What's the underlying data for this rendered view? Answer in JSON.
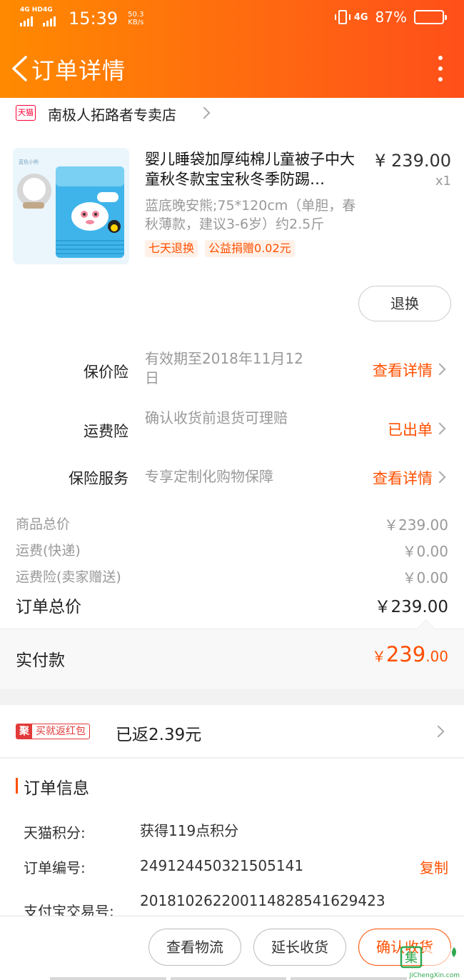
{
  "status_bar": {
    "net1": "4G HD",
    "net2": "4G",
    "time": "15:39",
    "speed_value": "50.3",
    "speed_unit": "KB/s",
    "net3": "4G",
    "battery_pct": "87%",
    "battery_level": 0.87
  },
  "nav": {
    "title": "订单详情"
  },
  "shop": {
    "badge": "天猫",
    "name": "南极人拓路者专卖店"
  },
  "product": {
    "title": "婴儿睡袋加厚纯棉儿童被子中大童秋冬款宝宝秋冬季防踢…",
    "price": "¥ 239.00",
    "qty": "x1",
    "sku": "蓝底晚安熊;75*120cm（单胆，春秋薄款，建议3-6岁）约2.5斤",
    "tags": [
      "七天退换",
      "公益捐赠0.02元"
    ],
    "return_button": "退换"
  },
  "services": [
    {
      "label": "保价险",
      "desc": "有效期至2018年11月12日",
      "link": "查看详情"
    },
    {
      "label": "运费险",
      "desc": "确认收货前退货可理赔",
      "link": "已出单"
    },
    {
      "label": "保险服务",
      "desc": "专享定制化购物保障",
      "link": "查看详情"
    }
  ],
  "costs": [
    {
      "label": "商品总价",
      "value": "￥239.00"
    },
    {
      "label": "运费(快递)",
      "value": "￥0.00"
    },
    {
      "label": "运费险(卖家赠送)",
      "value": "￥0.00"
    }
  ],
  "total": {
    "label": "订单总价",
    "value": "￥239.00"
  },
  "paid": {
    "label": "实付款",
    "currency": "￥",
    "integer": "239",
    "decimal": ".00"
  },
  "packet": {
    "badge_icon": "聚",
    "badge_text": "买就返红包",
    "text": "已返2.39元"
  },
  "order_info": {
    "title": "订单信息",
    "rows": [
      {
        "key": "天猫积分:",
        "value": "获得119点积分"
      },
      {
        "key": "订单编号:",
        "value": "249124450321505141",
        "action": "复制"
      },
      {
        "key": "支付宝交易号:",
        "value": "201810262200114828541629423"
      }
    ]
  },
  "actions": {
    "logistics": "查看物流",
    "extend": "延长收货",
    "confirm": "确认收货"
  },
  "watermark": {
    "logo": "集",
    "text": "JiChengXin.com"
  },
  "colors": {
    "accent": "#ff5000",
    "header_start": "#ff8a00",
    "header_end": "#ff4f1a"
  }
}
